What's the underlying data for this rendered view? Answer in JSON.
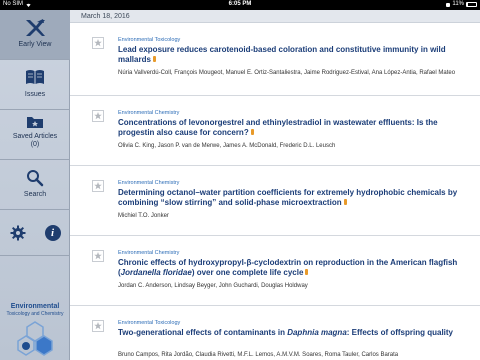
{
  "status_bar": {
    "carrier": "No SIM",
    "time": "6:05 PM",
    "battery_percent": "11%",
    "battery_level": 0.11
  },
  "sidebar": {
    "items": [
      {
        "label": "Early View",
        "icon": "early-view-logo-icon",
        "active": true
      },
      {
        "label": "Issues",
        "icon": "book-icon"
      },
      {
        "label": "Saved Articles\n(0)",
        "icon": "folder-icon"
      },
      {
        "label": "Search",
        "icon": "search-icon"
      }
    ],
    "settings_icon": "gear-icon",
    "info_icon": "info-icon",
    "info_glyph": "i",
    "journal": {
      "line1": "Environmental",
      "line2": "Toxicology and Chemistry",
      "logo": "etc-molecule-logo"
    }
  },
  "feed": {
    "date": "March 18, 2016",
    "articles": [
      {
        "section": "Environmental Toxicology",
        "title": "Lead exposure reduces carotenoid-based coloration and constitutive immunity in wild mallards",
        "authors": "Núria Vallverdú-Coll, François Mougeot, Manuel E. Ortiz-Santaliestra, Jaime Rodriguez-Estival, Ana López-Antia, Rafael Mateo"
      },
      {
        "section": "Environmental Chemistry",
        "title": "Concentrations of levonorgestrel and ethinylestradiol in wastewater effluents: Is the progestin also cause for concern?",
        "authors": "Olivia C. King, Jason P. van de Merwe, James A. McDonald, Frederic D.L. Leusch"
      },
      {
        "section": "Environmental Chemistry",
        "title": "Determining octanol–water partition coefficients for extremely hydrophobic chemicals by combining “slow stirring” and solid-phase microextraction",
        "authors": "Michiel T.O. Jonker"
      },
      {
        "section": "Environmental Chemistry",
        "title_parts": [
          "Chronic effects of hydroxypropyl-β-cyclodextrin on reproduction in the American flagfish (",
          "Jordanella floridae",
          ") over one complete life cycle"
        ],
        "authors": "Jordan C. Anderson, Lindsay Beyger, John Guchardi, Douglas Holdway"
      },
      {
        "section": "Environmental Toxicology",
        "title_parts": [
          "Two-generational effects of contaminants in ",
          "Daphnia magna",
          ": Effects of offspring quality"
        ],
        "authors": "Bruno Campos, Rita Jordão, Claudia Rivetti, M.F.L. Lemos, A.M.V.M. Soares, Roma Tauler, Carlos Barata"
      }
    ]
  },
  "colors": {
    "sidebar": "#c3ccd9",
    "title": "#1b3d78",
    "section": "#2d6db7",
    "pdf": "#e89a2a"
  }
}
